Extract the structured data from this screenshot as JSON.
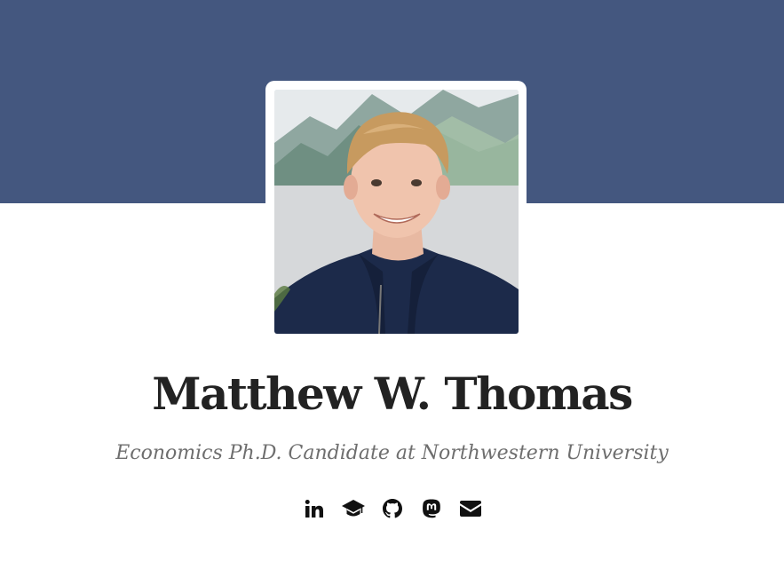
{
  "profile": {
    "name": "Matthew W. Thomas",
    "subtitle": "Economics Ph.D. Candidate at Northwestern University"
  },
  "colors": {
    "banner": "#44577f",
    "text": "#222222",
    "subtitle": "#6e6e6e"
  },
  "social_links": [
    {
      "icon": "linkedin-icon",
      "label": "LinkedIn"
    },
    {
      "icon": "graduation-cap-icon",
      "label": "Google Scholar"
    },
    {
      "icon": "github-icon",
      "label": "GitHub"
    },
    {
      "icon": "mastodon-icon",
      "label": "Mastodon"
    },
    {
      "icon": "envelope-icon",
      "label": "Email"
    }
  ]
}
